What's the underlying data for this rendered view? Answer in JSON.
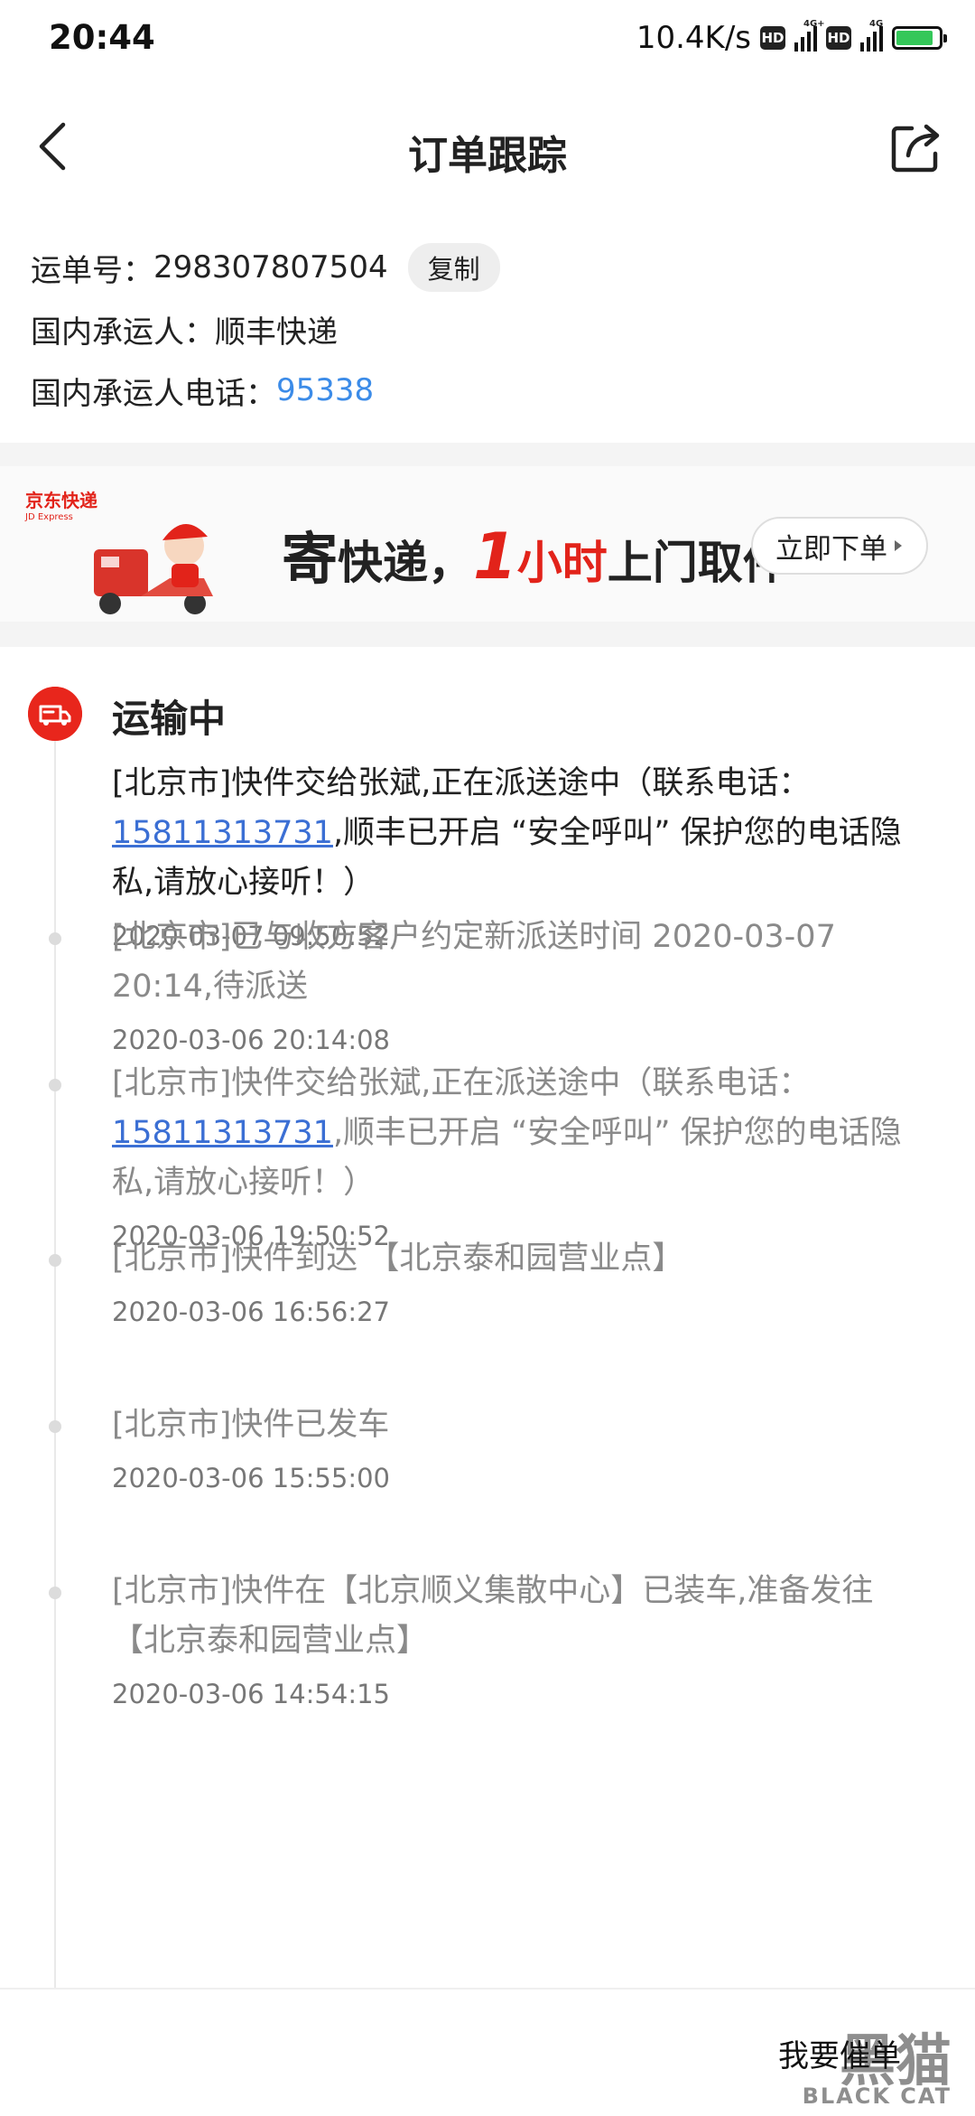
{
  "status_bar": {
    "time": "20:44",
    "net_speed": "10.4K/s",
    "hd_badge": "HD",
    "network_labels": [
      "4G+",
      "4G"
    ],
    "battery_color": "#34c759"
  },
  "nav": {
    "back_icon": "chevron-left-icon",
    "title": "订单跟踪",
    "share_icon": "share-icon"
  },
  "order": {
    "waybill_label": "运单号：",
    "waybill_number": "298307807504",
    "copy_label": "复制",
    "carrier_label": "国内承运人：",
    "carrier_name": "顺丰快递",
    "carrier_phone_label": "国内承运人电话：",
    "carrier_phone": "95338"
  },
  "banner": {
    "brand": "京东快递",
    "brand_en": "JD Express",
    "slogan_char": "寄",
    "slogan_part1": "快递，",
    "slogan_num": "1",
    "slogan_unit": "小时",
    "slogan_part2": "上门取件",
    "button_label": "立即下单",
    "accent_color": "#e2231a"
  },
  "tracking": {
    "status": "运输中",
    "status_color": "#e8261c",
    "events": [
      {
        "text_before": "[北京市]快件交给张斌,正在派送途中（联系电话：",
        "phone": "15811313731",
        "text_after": ",顺丰已开启 “安全呼叫” 保护您的电话隐私,请放心接听！）",
        "time": "2020-03-07 09:50:52"
      },
      {
        "text": "[北京市]已与收方客户约定新派送时间 2020-03-07 20:14,待派送",
        "time": "2020-03-06 20:14:08"
      },
      {
        "text_before": "[北京市]快件交给张斌,正在派送途中（联系电话：",
        "phone": "15811313731",
        "text_after": ",顺丰已开启 “安全呼叫” 保护您的电话隐私,请放心接听！）",
        "time": "2020-03-06 19:50:52"
      },
      {
        "text": "[北京市]快件到达 【北京泰和园营业点】",
        "time": "2020-03-06 16:56:27"
      },
      {
        "text": "[北京市]快件已发车",
        "time": "2020-03-06 15:55:00"
      },
      {
        "text": "[北京市]快件在【北京顺义集散中心】已装车,准备发往【北京泰和园营业点】",
        "time": "2020-03-06 14:54:15"
      }
    ]
  },
  "bottom": {
    "urge_label": "我要催单"
  },
  "watermark": {
    "zh": "黑猫",
    "en": "BLACK CAT"
  }
}
